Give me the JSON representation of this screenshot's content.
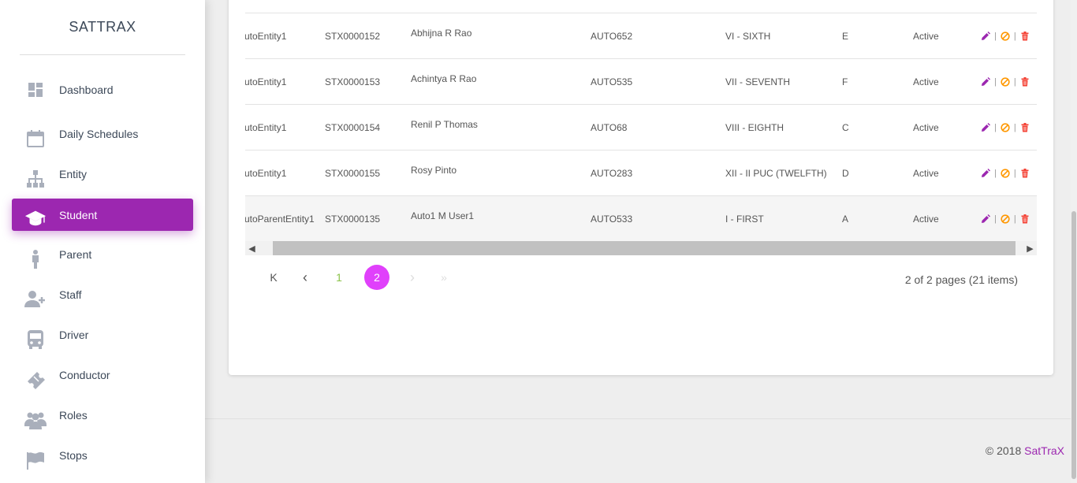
{
  "brand": "SATTRAX",
  "sidebar": {
    "items": [
      {
        "label": "Dashboard",
        "icon": "dashboard-icon"
      },
      {
        "label": "Daily Schedules",
        "icon": "calendar-icon"
      },
      {
        "label": "Entity",
        "icon": "hierarchy-icon"
      },
      {
        "label": "Student",
        "icon": "graduation-cap-icon",
        "active": true
      },
      {
        "label": "Parent",
        "icon": "person-icon"
      },
      {
        "label": "Staff",
        "icon": "add-user-icon"
      },
      {
        "label": "Driver",
        "icon": "bus-icon"
      },
      {
        "label": "Conductor",
        "icon": "ticket-icon"
      },
      {
        "label": "Roles",
        "icon": "group-icon"
      },
      {
        "label": "Stops",
        "icon": "flag-icon"
      }
    ]
  },
  "table": {
    "rows": [
      {
        "entity": "utoEntity1",
        "id": "STX0000152",
        "name": "Abhijna R Rao",
        "auto": "AUTO652",
        "class": "VI - SIXTH",
        "section": "E",
        "status": "Active"
      },
      {
        "entity": "utoEntity1",
        "id": "STX0000153",
        "name": "Achintya R Rao",
        "auto": "AUTO535",
        "class": "VII - SEVENTH",
        "section": "F",
        "status": "Active"
      },
      {
        "entity": "utoEntity1",
        "id": "STX0000154",
        "name": "Renil P Thomas",
        "auto": "AUTO68",
        "class": "VIII - EIGHTH",
        "section": "C",
        "status": "Active"
      },
      {
        "entity": "utoEntity1",
        "id": "STX0000155",
        "name": "Rosy Pinto",
        "auto": "AUTO283",
        "class": "XII - II PUC (TWELFTH)",
        "section": "D",
        "status": "Active"
      },
      {
        "entity": "utoParentEntity1",
        "id": "STX0000135",
        "name": "Auto1 M User1",
        "auto": "AUTO533",
        "class": "I - FIRST",
        "section": "A",
        "status": "Active"
      }
    ],
    "action_separator": "|"
  },
  "pagination": {
    "first": "K",
    "prev": "‹",
    "pages": [
      "1",
      "2"
    ],
    "current": "2",
    "next": "›",
    "last": "»",
    "info": "2 of 2 pages (21 items)"
  },
  "footer": {
    "copyright_prefix": "© 2018 ",
    "copyright_link": "SatTraX"
  },
  "colors": {
    "accent": "#9c27b0",
    "current_page": "#e040fb",
    "edit": "#9c27b0",
    "disable": "#ff9800",
    "delete": "#f44336"
  }
}
